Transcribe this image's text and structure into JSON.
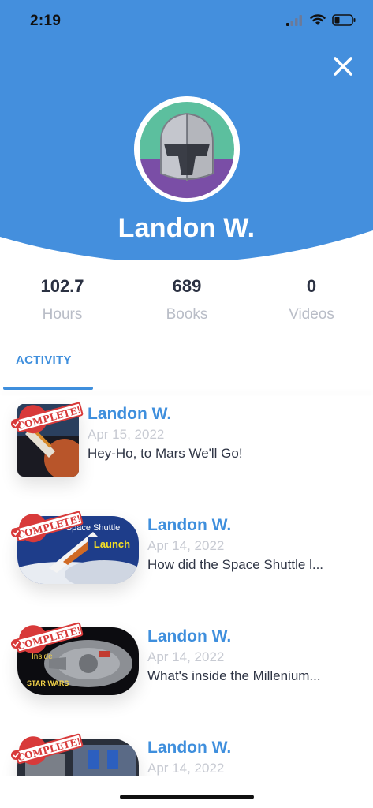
{
  "status_bar": {
    "time": "2:19"
  },
  "colors": {
    "header_blue": "#448fdd",
    "accent": "#3f8fdd",
    "complete_red": "#d83a3a"
  },
  "profile": {
    "name": "Landon W.",
    "avatar": "knight-helmet-icon"
  },
  "stats": [
    {
      "value": "102.7",
      "label": "Hours"
    },
    {
      "value": "689",
      "label": "Books"
    },
    {
      "value": "0",
      "label": "Videos"
    }
  ],
  "tabs": {
    "activity": "ACTIVITY"
  },
  "badge_text": "COMPLETE!",
  "feed": [
    {
      "title": "Landon W.",
      "date": "Apr 15, 2022",
      "description": "Hey-Ho, to Mars We'll Go!",
      "thumbnail": "mars-book-cover"
    },
    {
      "title": "Landon W.",
      "date": "Apr 14, 2022",
      "description": "How did the Space Shuttle l...",
      "thumbnail": "space-shuttle-launch",
      "thumb_text_1": "Space Shuttle",
      "thumb_text_2": "Launch"
    },
    {
      "title": "Landon W.",
      "date": "Apr 14, 2022",
      "description": "What's inside the Millenium...",
      "thumbnail": "millennium-falcon",
      "thumb_text_1": "Inside",
      "thumb_text_2": "STAR WARS"
    },
    {
      "title": "Landon W.",
      "date": "Apr 14, 2022",
      "description": "",
      "thumbnail": "cockpit-video"
    }
  ]
}
